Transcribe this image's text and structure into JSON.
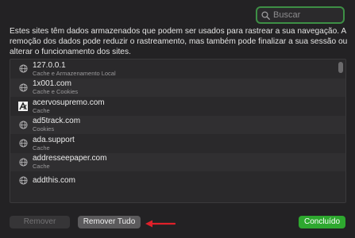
{
  "search": {
    "placeholder": "Buscar",
    "value": ""
  },
  "description": "Estes sites têm dados armazenados que podem ser usados para rastrear a sua navegação. A remoção dos dados pode reduzir o rastreamento, mas também pode finalizar a sua sessão ou alterar o funcionamento dos sites.",
  "sites": [
    {
      "name": "127.0.0.1",
      "detail": "Cache e Armazenamento Local",
      "icon": "globe-icon"
    },
    {
      "name": "1x001.com",
      "detail": "Cache e Cookies",
      "icon": "globe-icon"
    },
    {
      "name": "acervosupremo.com",
      "detail": "Cache",
      "icon": "site-favicon-icon"
    },
    {
      "name": "ad5track.com",
      "detail": "Cookies",
      "icon": "globe-icon"
    },
    {
      "name": "ada.support",
      "detail": "Cache",
      "icon": "globe-icon"
    },
    {
      "name": "addresseepaper.com",
      "detail": "Cache",
      "icon": "globe-icon"
    },
    {
      "name": "addthis.com",
      "detail": "",
      "icon": "globe-icon"
    }
  ],
  "buttons": {
    "remove": "Remover",
    "remove_all": "Remover Tudo",
    "done": "Concluído"
  },
  "colors": {
    "accent_green": "#2ea82f",
    "search_focus": "#3d8f45",
    "annotation_arrow": "#e0202a"
  }
}
